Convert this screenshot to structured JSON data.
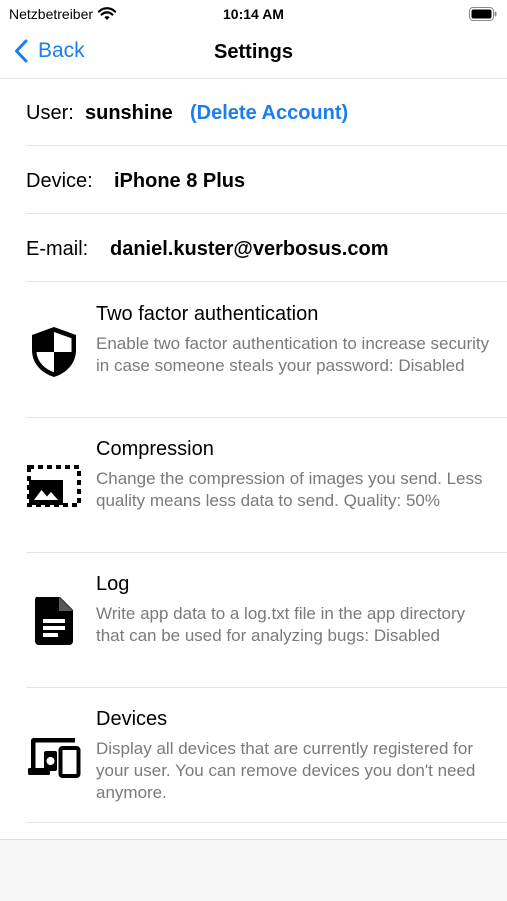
{
  "status_bar": {
    "carrier": "Netzbetreiber",
    "time": "10:14 AM"
  },
  "nav": {
    "back_label": "Back",
    "title": "Settings",
    "accent_color": "#1a7ef0"
  },
  "account": {
    "user_label": "User:",
    "user_value": "sunshine",
    "delete_label": "(Delete Account)",
    "device_label": "Device:",
    "device_value": "iPhone 8 Plus",
    "email_label": "E-mail:",
    "email_value": "daniel.kuster@verbosus.com"
  },
  "features": [
    {
      "icon": "shield-icon",
      "title": "Two factor authentication",
      "description": "Enable two factor authentication to increase security in case someone steals your password: Disabled"
    },
    {
      "icon": "image-compression-icon",
      "title": "Compression",
      "description": "Change the compression of images you send. Less quality means less data to send. Quality: 50%"
    },
    {
      "icon": "document-icon",
      "title": "Log",
      "description": "Write app data to a log.txt file in the app directory that can be used for analyzing bugs: Disabled"
    },
    {
      "icon": "devices-icon",
      "title": "Devices",
      "description": "Display all devices that are currently registered for your user. You can remove devices you don't need anymore."
    }
  ]
}
